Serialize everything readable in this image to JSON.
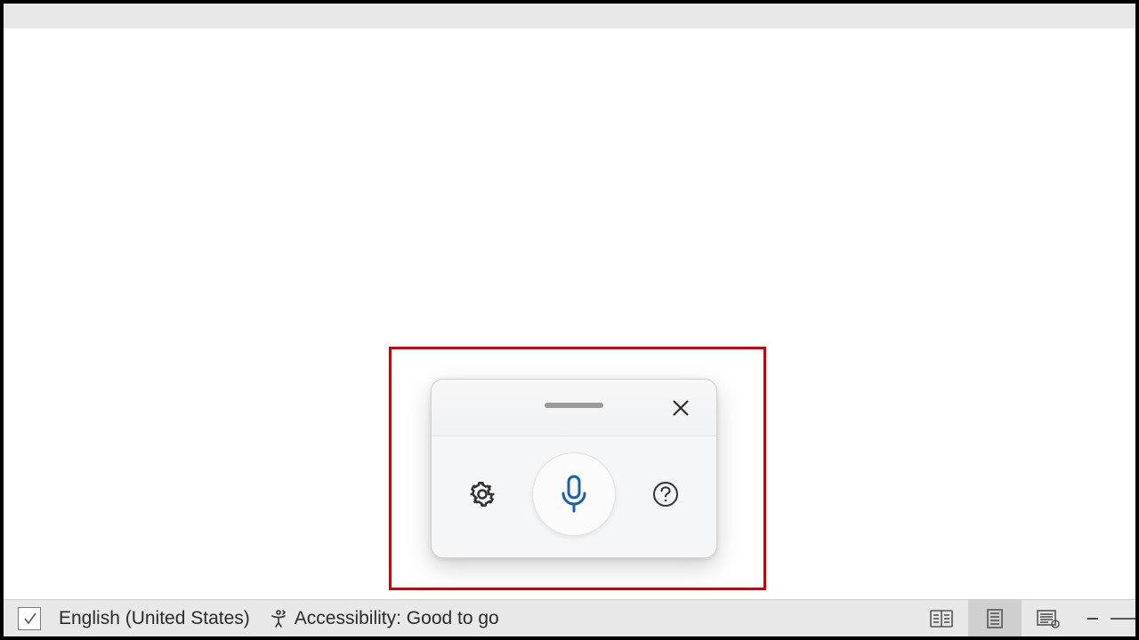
{
  "statusbar": {
    "language": "English (United States)",
    "accessibility": "Accessibility: Good to go"
  },
  "dictate": {
    "settings_icon": "gear-icon",
    "mic_icon": "microphone-icon",
    "help_icon": "help-icon",
    "close_icon": "close-icon",
    "drag_icon": "drag-handle-icon"
  },
  "colors": {
    "mic_accent": "#1a5fb4",
    "highlight": "#d40000"
  }
}
